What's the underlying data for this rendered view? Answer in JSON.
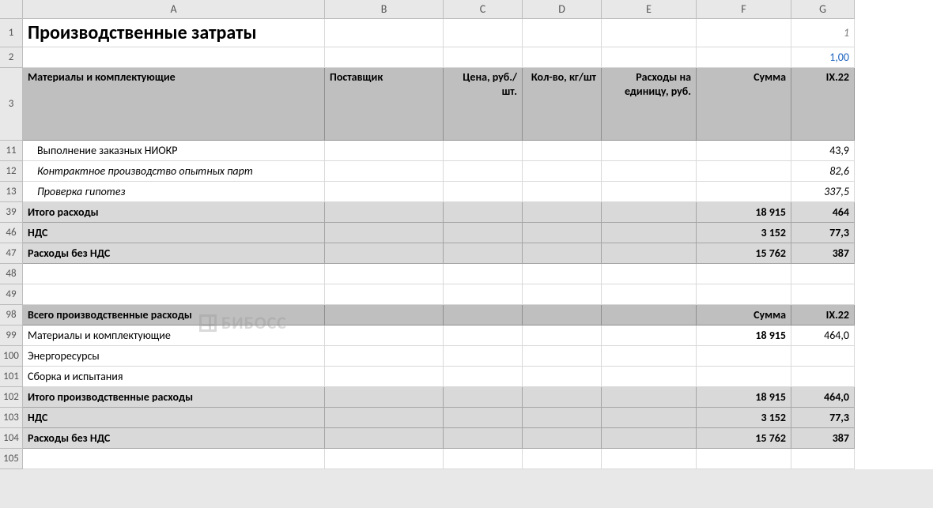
{
  "columns": [
    "A",
    "B",
    "C",
    "D",
    "E",
    "F",
    "G"
  ],
  "row_numbers": [
    "1",
    "2",
    "3",
    "11",
    "12",
    "13",
    "39",
    "46",
    "47",
    "48",
    "49",
    "98",
    "99",
    "100",
    "101",
    "102",
    "103",
    "104",
    "105"
  ],
  "title": "Производственные затраты",
  "r1_g": "1",
  "r2_g": "1,00",
  "headers": {
    "A": "Материалы и комплектующие",
    "B": "Поставщик",
    "C": "Цена, руб./шт.",
    "D": "Кол-во, кг/шт",
    "E": "Расходы на единицу, руб.",
    "F": "Сумма",
    "G": "IX.22"
  },
  "r11": {
    "A": "Выполнение заказных НИОКР",
    "G": "43,9"
  },
  "r12": {
    "A": "Контрактное производство опытных парт",
    "G": "82,6"
  },
  "r13": {
    "A": "Проверка гипотез",
    "G": "337,5"
  },
  "r39": {
    "A": "Итого расходы",
    "F": "18 915",
    "G": "464"
  },
  "r46": {
    "A": "НДС",
    "F": "3 152",
    "G": "77,3"
  },
  "r47": {
    "A": "Расходы без НДС",
    "F": "15 762",
    "G": "387"
  },
  "r98": {
    "A": "Всего производственные расходы",
    "F": "Сумма",
    "G": "IX.22"
  },
  "r99": {
    "A": "Материалы и комплектующие",
    "F": "18 915",
    "G": "464,0"
  },
  "r100": {
    "A": "Энергоресурсы"
  },
  "r101": {
    "A": "Сборка и испытания"
  },
  "r102": {
    "A": "Итого производственные расходы",
    "F": "18 915",
    "G": "464,0"
  },
  "r103": {
    "A": "НДС",
    "F": "3 152",
    "G": "77,3"
  },
  "r104": {
    "A": "Расходы без НДС",
    "F": "15 762",
    "G": "387"
  },
  "watermark": "БИБОСС"
}
